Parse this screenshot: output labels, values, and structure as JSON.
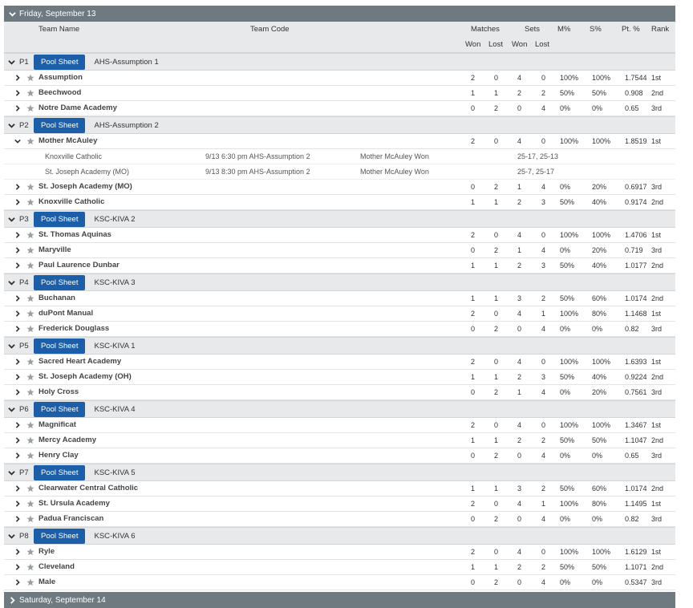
{
  "days": [
    {
      "label": "Friday, September 13",
      "expanded": true
    },
    {
      "label": "Saturday, September 14",
      "expanded": false
    }
  ],
  "columns": {
    "team_name": "Team Name",
    "team_code": "Team Code",
    "matches": "Matches",
    "sets": "Sets",
    "mpct": "M%",
    "spct": "S%",
    "ptpct": "Pt. %",
    "rank": "Rank",
    "won": "Won",
    "lost": "Lost"
  },
  "pool_sheet_label": "Pool Sheet",
  "pools": [
    {
      "name": "P1",
      "code": "AHS-Assumption 1",
      "teams": [
        {
          "name": "Assumption",
          "mw": "2",
          "ml": "0",
          "sw": "4",
          "sl": "0",
          "mp": "100%",
          "sp": "100%",
          "pt": "1.7544",
          "rank": "1st"
        },
        {
          "name": "Beechwood",
          "mw": "1",
          "ml": "1",
          "sw": "2",
          "sl": "2",
          "mp": "50%",
          "sp": "50%",
          "pt": "0.908",
          "rank": "2nd"
        },
        {
          "name": "Notre Dame Academy",
          "mw": "0",
          "ml": "2",
          "sw": "0",
          "sl": "4",
          "mp": "0%",
          "sp": "0%",
          "pt": "0.65",
          "rank": "3rd"
        }
      ]
    },
    {
      "name": "P2",
      "code": "AHS-Assumption 2",
      "teams": [
        {
          "name": "Mother McAuley",
          "mw": "2",
          "ml": "0",
          "sw": "4",
          "sl": "0",
          "mp": "100%",
          "sp": "100%",
          "pt": "1.8519",
          "rank": "1st",
          "expanded": true,
          "matches": [
            {
              "opponent": "Knoxville Catholic",
              "when": "9/13 6:30 pm AHS-Assumption 2",
              "result": "Mother McAuley Won",
              "score": "25-17, 25-13"
            },
            {
              "opponent": "St. Joseph Academy (MO)",
              "when": "9/13 8:30 pm AHS-Assumption 2",
              "result": "Mother McAuley Won",
              "score": "25-7, 25-17"
            }
          ]
        },
        {
          "name": "St. Joseph Academy (MO)",
          "mw": "0",
          "ml": "2",
          "sw": "1",
          "sl": "4",
          "mp": "0%",
          "sp": "20%",
          "pt": "0.6917",
          "rank": "3rd"
        },
        {
          "name": "Knoxville Catholic",
          "mw": "1",
          "ml": "1",
          "sw": "2",
          "sl": "3",
          "mp": "50%",
          "sp": "40%",
          "pt": "0.9174",
          "rank": "2nd"
        }
      ]
    },
    {
      "name": "P3",
      "code": "KSC-KIVA 2",
      "teams": [
        {
          "name": "St. Thomas Aquinas",
          "mw": "2",
          "ml": "0",
          "sw": "4",
          "sl": "0",
          "mp": "100%",
          "sp": "100%",
          "pt": "1.4706",
          "rank": "1st"
        },
        {
          "name": "Maryville",
          "mw": "0",
          "ml": "2",
          "sw": "1",
          "sl": "4",
          "mp": "0%",
          "sp": "20%",
          "pt": "0.719",
          "rank": "3rd"
        },
        {
          "name": "Paul Laurence Dunbar",
          "mw": "1",
          "ml": "1",
          "sw": "2",
          "sl": "3",
          "mp": "50%",
          "sp": "40%",
          "pt": "1.0177",
          "rank": "2nd"
        }
      ]
    },
    {
      "name": "P4",
      "code": "KSC-KIVA 3",
      "teams": [
        {
          "name": "Buchanan",
          "mw": "1",
          "ml": "1",
          "sw": "3",
          "sl": "2",
          "mp": "50%",
          "sp": "60%",
          "pt": "1.0174",
          "rank": "2nd"
        },
        {
          "name": "duPont Manual",
          "mw": "2",
          "ml": "0",
          "sw": "4",
          "sl": "1",
          "mp": "100%",
          "sp": "80%",
          "pt": "1.1468",
          "rank": "1st"
        },
        {
          "name": "Frederick Douglass",
          "mw": "0",
          "ml": "2",
          "sw": "0",
          "sl": "4",
          "mp": "0%",
          "sp": "0%",
          "pt": "0.82",
          "rank": "3rd"
        }
      ]
    },
    {
      "name": "P5",
      "code": "KSC-KIVA 1",
      "teams": [
        {
          "name": "Sacred Heart Academy",
          "mw": "2",
          "ml": "0",
          "sw": "4",
          "sl": "0",
          "mp": "100%",
          "sp": "100%",
          "pt": "1.6393",
          "rank": "1st"
        },
        {
          "name": "St. Joseph Academy (OH)",
          "mw": "1",
          "ml": "1",
          "sw": "2",
          "sl": "3",
          "mp": "50%",
          "sp": "40%",
          "pt": "0.9224",
          "rank": "2nd"
        },
        {
          "name": "Holy Cross",
          "mw": "0",
          "ml": "2",
          "sw": "1",
          "sl": "4",
          "mp": "0%",
          "sp": "20%",
          "pt": "0.7561",
          "rank": "3rd"
        }
      ]
    },
    {
      "name": "P6",
      "code": "KSC-KIVA 4",
      "teams": [
        {
          "name": "Magnificat",
          "mw": "2",
          "ml": "0",
          "sw": "4",
          "sl": "0",
          "mp": "100%",
          "sp": "100%",
          "pt": "1.3467",
          "rank": "1st"
        },
        {
          "name": "Mercy Academy",
          "mw": "1",
          "ml": "1",
          "sw": "2",
          "sl": "2",
          "mp": "50%",
          "sp": "50%",
          "pt": "1.1047",
          "rank": "2nd"
        },
        {
          "name": "Henry Clay",
          "mw": "0",
          "ml": "2",
          "sw": "0",
          "sl": "4",
          "mp": "0%",
          "sp": "0%",
          "pt": "0.65",
          "rank": "3rd"
        }
      ]
    },
    {
      "name": "P7",
      "code": "KSC-KIVA 5",
      "teams": [
        {
          "name": "Clearwater Central Catholic",
          "mw": "1",
          "ml": "1",
          "sw": "3",
          "sl": "2",
          "mp": "50%",
          "sp": "60%",
          "pt": "1.0174",
          "rank": "2nd"
        },
        {
          "name": "St. Ursula Academy",
          "mw": "2",
          "ml": "0",
          "sw": "4",
          "sl": "1",
          "mp": "100%",
          "sp": "80%",
          "pt": "1.1495",
          "rank": "1st"
        },
        {
          "name": "Padua Franciscan",
          "mw": "0",
          "ml": "2",
          "sw": "0",
          "sl": "4",
          "mp": "0%",
          "sp": "0%",
          "pt": "0.82",
          "rank": "3rd"
        }
      ]
    },
    {
      "name": "P8",
      "code": "KSC-KIVA 6",
      "teams": [
        {
          "name": "Ryle",
          "mw": "2",
          "ml": "0",
          "sw": "4",
          "sl": "0",
          "mp": "100%",
          "sp": "100%",
          "pt": "1.6129",
          "rank": "1st"
        },
        {
          "name": "Cleveland",
          "mw": "1",
          "ml": "1",
          "sw": "2",
          "sl": "2",
          "mp": "50%",
          "sp": "50%",
          "pt": "1.1071",
          "rank": "2nd"
        },
        {
          "name": "Male",
          "mw": "0",
          "ml": "2",
          "sw": "0",
          "sl": "4",
          "mp": "0%",
          "sp": "0%",
          "pt": "0.5347",
          "rank": "3rd"
        }
      ]
    }
  ],
  "colors": {
    "header_bar": "#6e7a80",
    "pool_bg": "#e7e9ea",
    "button": "#1c5fa8",
    "star": "#9a9fa3"
  },
  "icons": {
    "expand": "chevron-right-icon",
    "collapse": "chevron-down-icon",
    "favorite": "star-icon"
  }
}
